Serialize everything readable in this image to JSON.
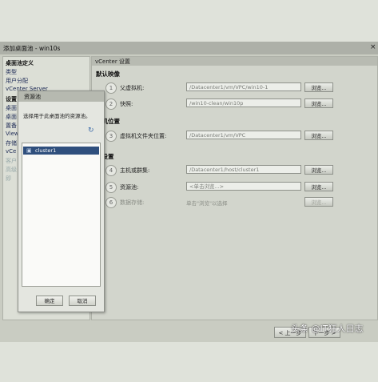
{
  "window": {
    "title": "添加桌面池 - win10s",
    "close_glyph": "×"
  },
  "nav": {
    "items": [
      {
        "label": "桌面池定义",
        "kind": "head"
      },
      {
        "label": "类型",
        "kind": "link"
      },
      {
        "label": "用户分配",
        "kind": "link"
      },
      {
        "label": "vCenter Server",
        "kind": "link"
      },
      {
        "label": "设置",
        "kind": "head"
      },
      {
        "label": "桌面",
        "kind": "link"
      },
      {
        "label": "桌面",
        "kind": "link"
      },
      {
        "label": "置备",
        "kind": "link"
      },
      {
        "label": "View",
        "kind": "link"
      },
      {
        "label": "存储",
        "kind": "link"
      },
      {
        "label": "vCe",
        "kind": "link"
      },
      {
        "label": "客户",
        "kind": "dim"
      },
      {
        "label": "高级",
        "kind": "dim"
      },
      {
        "label": "即",
        "kind": "dim"
      }
    ]
  },
  "content": {
    "title": "vCenter 设置",
    "sections": {
      "default_image": "默认映像",
      "vm_location": "拟机位置",
      "resource_settings": "源设置"
    },
    "rows": [
      {
        "num": "1",
        "label": "父虚拟机:",
        "value": "/Datacenter1/vm/VPC/win10-1",
        "button": "浏览..."
      },
      {
        "num": "2",
        "label": "快照:",
        "value": "/win10-clean/win10p",
        "button": "浏览..."
      },
      {
        "num": "3",
        "label": "虚拟机文件夹位置:",
        "value": "/Datacenter1/vm/VPC",
        "button": "浏览..."
      },
      {
        "num": "4",
        "label": "主机或群集:",
        "value": "/Datacenter1/host/cluster1",
        "button": "浏览..."
      },
      {
        "num": "5",
        "label": "资源池:",
        "value": "<单击浏览...>",
        "button": "浏览..."
      },
      {
        "num": "6",
        "label": "数据存储:",
        "hint": "单击\"浏览\"以选择",
        "button": "浏览..."
      }
    ]
  },
  "footer": {
    "prev": "< 上一步",
    "next": "下一步 >"
  },
  "dialog": {
    "title": "资源池",
    "description": "选择用于此桌面池的资源池。",
    "tree": [
      {
        "label": "cluster1",
        "selected": true
      }
    ],
    "ok": "确定",
    "cancel": "取消"
  },
  "watermark": "头条 @IT狂人日志"
}
